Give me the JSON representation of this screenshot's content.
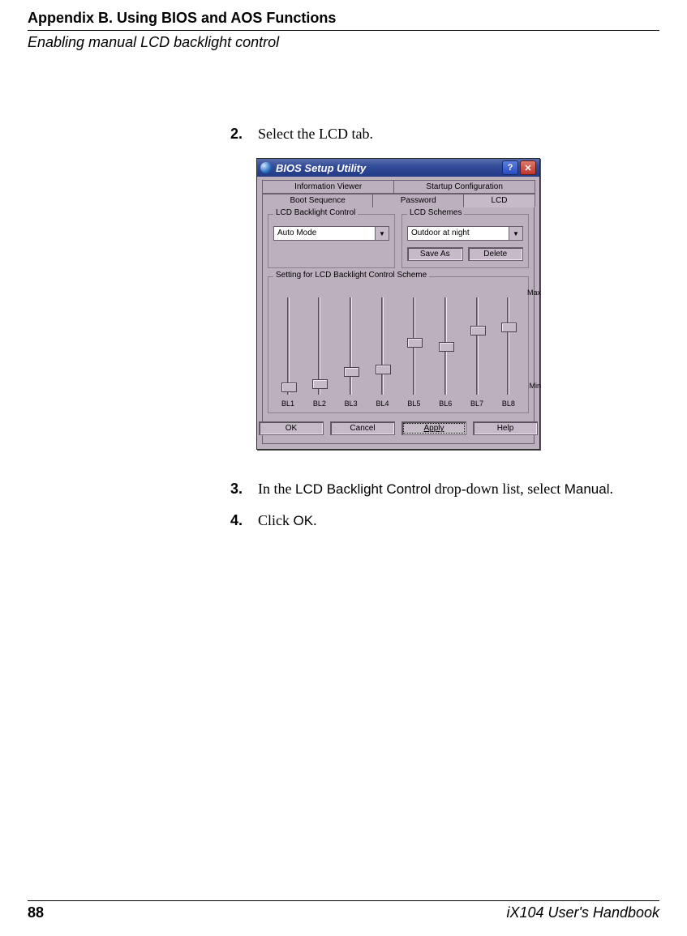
{
  "header": {
    "appendix": "Appendix B. Using BIOS and AOS Functions",
    "section": "Enabling manual LCD backlight control"
  },
  "steps": {
    "s2": {
      "num": "2.",
      "text": "Select the LCD tab."
    },
    "s3": {
      "num": "3.",
      "pre": "In the ",
      "term1": "LCD Backlight Control",
      "mid": " drop-down list, select ",
      "term2": "Manual",
      "post": "."
    },
    "s4": {
      "num": "4.",
      "pre": "Click ",
      "term": "OK",
      "post": "."
    }
  },
  "win": {
    "title": "BIOS Setup Utility",
    "tabs_row1": [
      "Information Viewer",
      "Startup Configuration"
    ],
    "tabs_row2": [
      "Boot Sequence",
      "Password",
      "LCD"
    ],
    "groups": {
      "backlight": {
        "label": "LCD Backlight Control",
        "value": "Auto Mode"
      },
      "schemes": {
        "label": "LCD Schemes",
        "value": "Outdoor at night",
        "save": "Save As",
        "delete": "Delete"
      },
      "sliders": {
        "label": "Setting for LCD Backlight Control Scheme",
        "max": "Max",
        "min": "Min",
        "cols": [
          {
            "name": "BL1",
            "pct": 5
          },
          {
            "name": "BL2",
            "pct": 8
          },
          {
            "name": "BL3",
            "pct": 22
          },
          {
            "name": "BL4",
            "pct": 25
          },
          {
            "name": "BL5",
            "pct": 55
          },
          {
            "name": "BL6",
            "pct": 50
          },
          {
            "name": "BL7",
            "pct": 68
          },
          {
            "name": "BL8",
            "pct": 72
          }
        ]
      }
    },
    "buttons": {
      "ok": "OK",
      "cancel": "Cancel",
      "apply": "Apply",
      "help": "Help"
    }
  },
  "footer": {
    "page": "88",
    "book": "iX104 User's Handbook"
  }
}
